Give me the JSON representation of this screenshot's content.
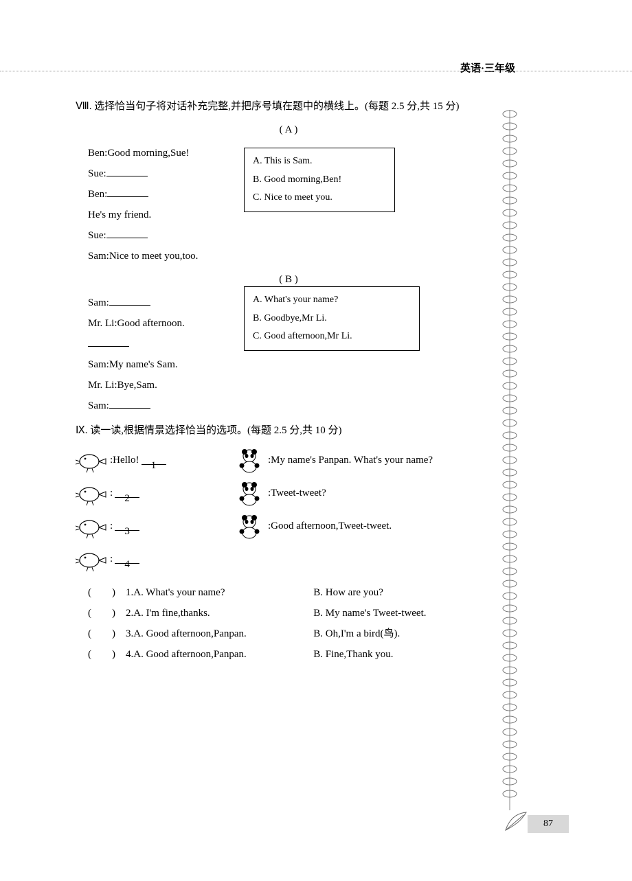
{
  "header": {
    "subject": "英语·三年级"
  },
  "section8": {
    "title": "Ⅷ. 选择恰当句子将对话补充完整,并把序号填在题中的横线上。(每题 2.5 分,共 15 分)",
    "partA": {
      "label": "( A )",
      "lines": [
        "Ben:Good morning,Sue!",
        "Sue:",
        "Ben:",
        "He's my friend.",
        "Sue:",
        "Sam:Nice to meet you,too."
      ],
      "options": {
        "a": "A. This is Sam.",
        "b": "B. Good morning,Ben!",
        "c": "C. Nice to meet you."
      }
    },
    "partB": {
      "label": "( B )",
      "lines": [
        "Sam:",
        "Mr. Li:Good afternoon.",
        "",
        "Sam:My name's Sam.",
        "Mr. Li:Bye,Sam.",
        "Sam:"
      ],
      "options": {
        "a": "A. What's your name?",
        "b": "B. Goodbye,Mr Li.",
        "c": "C. Good afternoon,Mr Li."
      }
    }
  },
  "section9": {
    "title": "Ⅸ. 读一读,根据情景选择恰当的选项。(每题 2.5 分,共 10 分)",
    "rows": [
      {
        "left": ":Hello!",
        "num": "1",
        "right": ":My name's Panpan. What's your name?"
      },
      {
        "left": ":",
        "num": "2",
        "right": ":Tweet-tweet?"
      },
      {
        "left": ":",
        "num": "3",
        "right": ":Good afternoon,Tweet-tweet."
      },
      {
        "left": ":",
        "num": "4",
        "right": ""
      }
    ],
    "choices": [
      {
        "n": "1",
        "a": "A. What's your name?",
        "b": "B. How are you?"
      },
      {
        "n": "2",
        "a": "A. I'm fine,thanks.",
        "b": "B. My name's Tweet-tweet."
      },
      {
        "n": "3",
        "a": "A. Good afternoon,Panpan.",
        "b": "B. Oh,I'm a bird(鸟)."
      },
      {
        "n": "4",
        "a": "A. Good afternoon,Panpan.",
        "b": "B. Fine,Thank you."
      }
    ]
  },
  "pageNumber": "87",
  "icons": {
    "bird": "bird-icon",
    "panda": "panda-icon",
    "spiral": "spiral-icon",
    "feather": "feather-icon"
  }
}
